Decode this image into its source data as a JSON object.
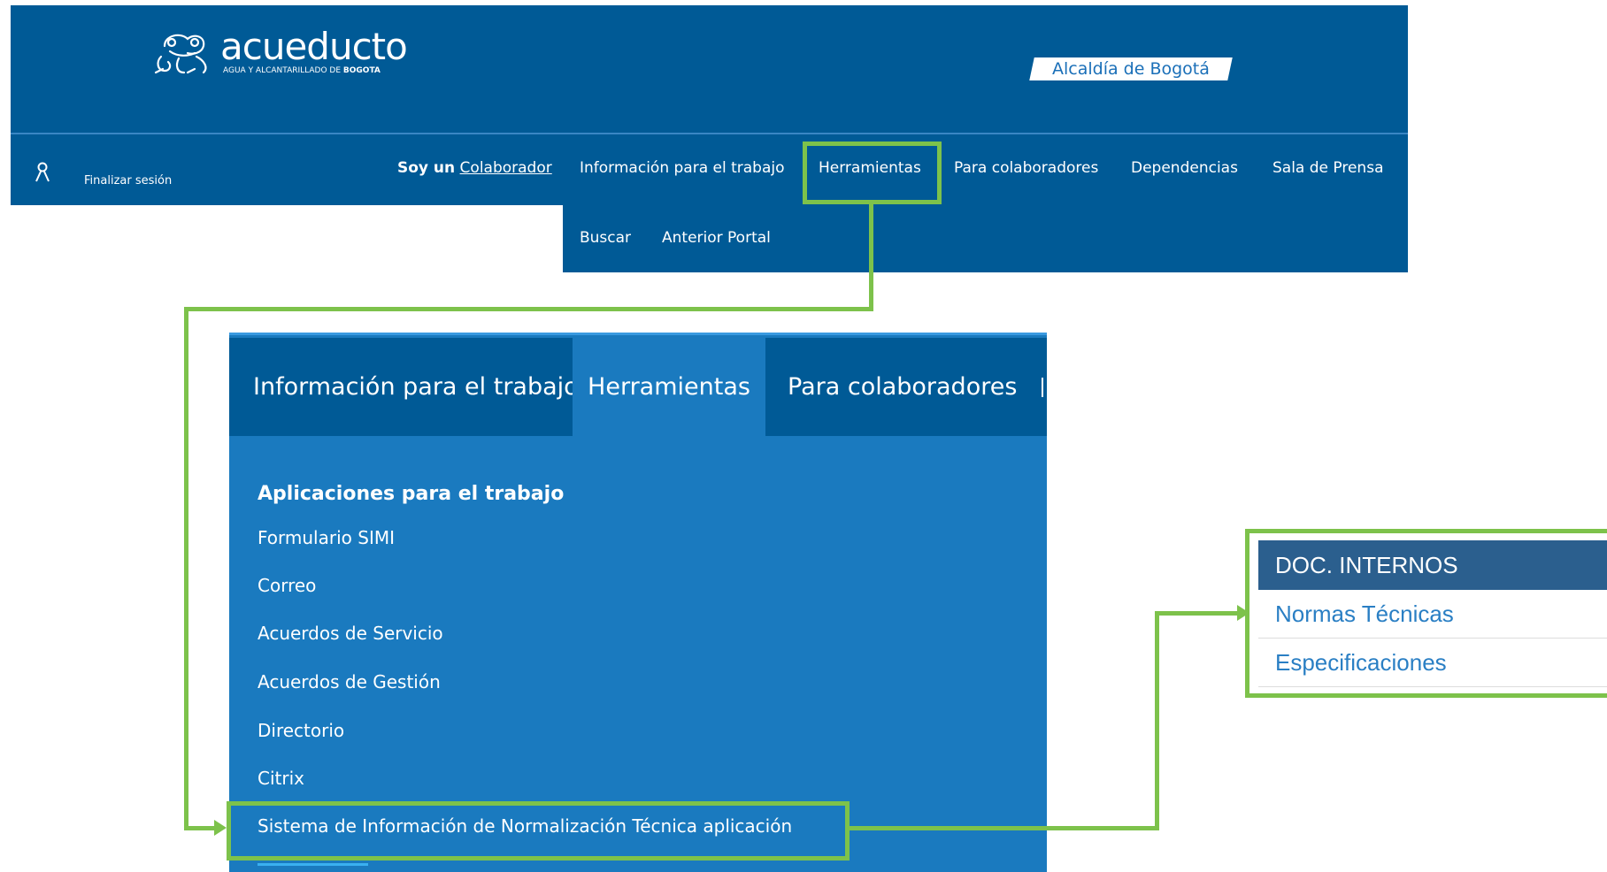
{
  "header": {
    "logo_word": "acueducto",
    "logo_tag_prefix": "AGUA Y ALCANTARILLADO DE",
    "logo_tag_city": "BOGOTA",
    "alcaldia": "Alcaldía de Bogotá"
  },
  "nav": {
    "user_icon": "user-icon",
    "logout": "Finalizar sesión",
    "soy_un": "Soy un",
    "colaborador": "Colaborador",
    "items": [
      "Información para el trabajo",
      "Herramientas",
      "Para colaboradores",
      "Dependencias",
      "Sala de Prensa",
      "Buscar",
      "Anterior Portal"
    ]
  },
  "mega": {
    "tabs": [
      "Información para el trabajo",
      "Herramientas",
      "Para colaboradores"
    ],
    "heading": "Aplicaciones para el trabajo",
    "links": [
      "Formulario SIMI",
      "Correo",
      "Acuerdos de Servicio",
      "Acuerdos de Gestión",
      "Directorio",
      "Citrix",
      "Sistema de Información de Normalización Técnica aplicación"
    ]
  },
  "doc": {
    "header": "DOC. INTERNOS",
    "items": [
      "Normas Técnicas",
      "Especificaciones"
    ]
  },
  "colors": {
    "brand_dark": "#005a96",
    "brand_light": "#1a7abf",
    "highlight": "#7dc24b"
  }
}
